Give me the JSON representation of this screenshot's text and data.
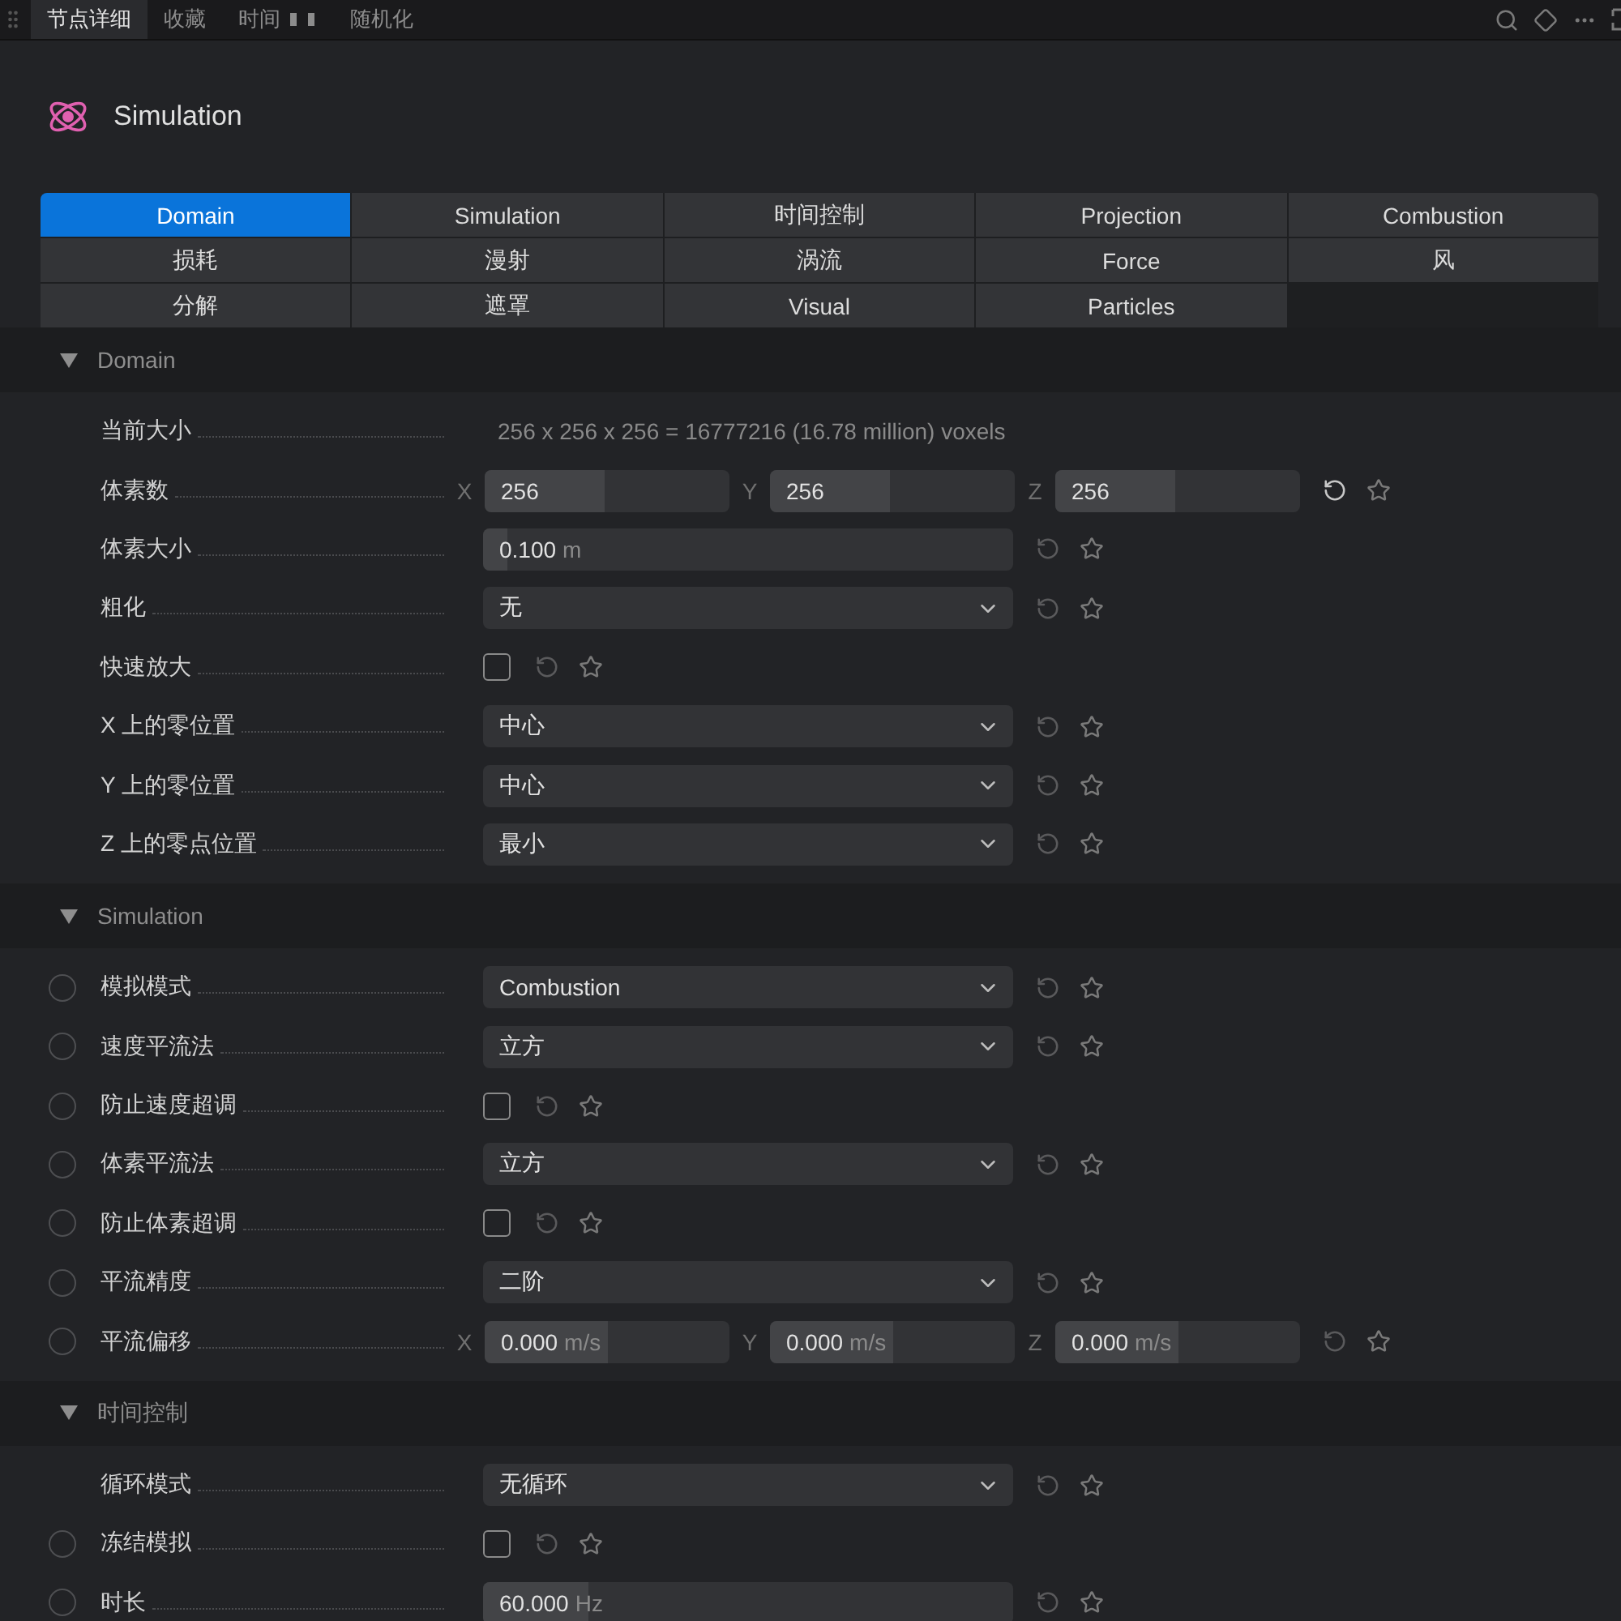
{
  "top_tabs": [
    {
      "label": "节点详细",
      "selected": true,
      "kind": "plain"
    },
    {
      "label": "收藏",
      "selected": false,
      "kind": "plain"
    },
    {
      "label": "时间",
      "selected": false,
      "kind": "bars"
    },
    {
      "label": "随机化",
      "selected": false,
      "kind": "plain"
    }
  ],
  "node": {
    "title": "Simulation"
  },
  "section_tabs": [
    {
      "label": "Domain",
      "selected": true
    },
    {
      "label": "Simulation",
      "selected": false
    },
    {
      "label": "时间控制",
      "selected": false
    },
    {
      "label": "Projection",
      "selected": false
    },
    {
      "label": "Combustion",
      "selected": false
    },
    {
      "label": "损耗",
      "selected": false
    },
    {
      "label": "漫射",
      "selected": false
    },
    {
      "label": "涡流",
      "selected": false
    },
    {
      "label": "Force",
      "selected": false
    },
    {
      "label": "风",
      "selected": false
    },
    {
      "label": "分解",
      "selected": false
    },
    {
      "label": "遮罩",
      "selected": false
    },
    {
      "label": "Visual",
      "selected": false
    },
    {
      "label": "Particles",
      "selected": false
    }
  ],
  "sections": [
    {
      "title": "Domain",
      "expanded": true,
      "rows": [
        {
          "kind": "info",
          "label": "当前大小",
          "value": "256 x 256 x 256 = 16777216 (16.78 million) voxels"
        },
        {
          "kind": "vector",
          "label": "体素数",
          "keyframe": false,
          "modified": true,
          "axes": [
            {
              "axis": "X",
              "value": "256",
              "level": 0.49
            },
            {
              "axis": "Y",
              "value": "256",
              "level": 0.49
            },
            {
              "axis": "Z",
              "value": "256",
              "level": 0.49
            }
          ]
        },
        {
          "kind": "number",
          "label": "体素大小",
          "keyframe": false,
          "modified": false,
          "value": "0.100",
          "unit": "m",
          "level": 0.045
        },
        {
          "kind": "select",
          "label": "粗化",
          "keyframe": false,
          "modified": false,
          "value": "无"
        },
        {
          "kind": "checkbox",
          "label": "快速放大",
          "keyframe": false,
          "modified": false,
          "checked": false
        },
        {
          "kind": "select",
          "label": "X 上的零位置",
          "keyframe": false,
          "modified": false,
          "value": "中心"
        },
        {
          "kind": "select",
          "label": "Y 上的零位置",
          "keyframe": false,
          "modified": false,
          "value": "中心"
        },
        {
          "kind": "select",
          "label": "Z 上的零点位置",
          "keyframe": false,
          "modified": false,
          "value": "最小"
        }
      ]
    },
    {
      "title": "Simulation",
      "expanded": true,
      "rows": [
        {
          "kind": "select",
          "label": "模拟模式",
          "keyframe": true,
          "modified": false,
          "value": "Combustion"
        },
        {
          "kind": "select",
          "label": "速度平流法",
          "keyframe": true,
          "modified": false,
          "value": "立方"
        },
        {
          "kind": "checkbox",
          "label": "防止速度超调",
          "keyframe": true,
          "modified": false,
          "checked": false
        },
        {
          "kind": "select",
          "label": "体素平流法",
          "keyframe": true,
          "modified": false,
          "value": "立方"
        },
        {
          "kind": "checkbox",
          "label": "防止体素超调",
          "keyframe": true,
          "modified": false,
          "checked": false
        },
        {
          "kind": "select",
          "label": "平流精度",
          "keyframe": true,
          "modified": false,
          "value": "二阶"
        },
        {
          "kind": "vector",
          "label": "平流偏移",
          "keyframe": true,
          "modified": false,
          "axes": [
            {
              "axis": "X",
              "value": "0.000",
              "unit": "m/s",
              "level": 0.5
            },
            {
              "axis": "Y",
              "value": "0.000",
              "unit": "m/s",
              "level": 0.5
            },
            {
              "axis": "Z",
              "value": "0.000",
              "unit": "m/s",
              "level": 0.5
            }
          ]
        }
      ]
    },
    {
      "title": "时间控制",
      "expanded": true,
      "rows": [
        {
          "kind": "select",
          "label": "循环模式",
          "keyframe": false,
          "modified": false,
          "value": "无循环"
        },
        {
          "kind": "checkbox",
          "label": "冻结模拟",
          "keyframe": true,
          "modified": false,
          "checked": false
        },
        {
          "kind": "number",
          "label": "时长",
          "keyframe": true,
          "modified": false,
          "value": "60.000",
          "unit": "Hz",
          "level": 0.2
        }
      ]
    }
  ]
}
